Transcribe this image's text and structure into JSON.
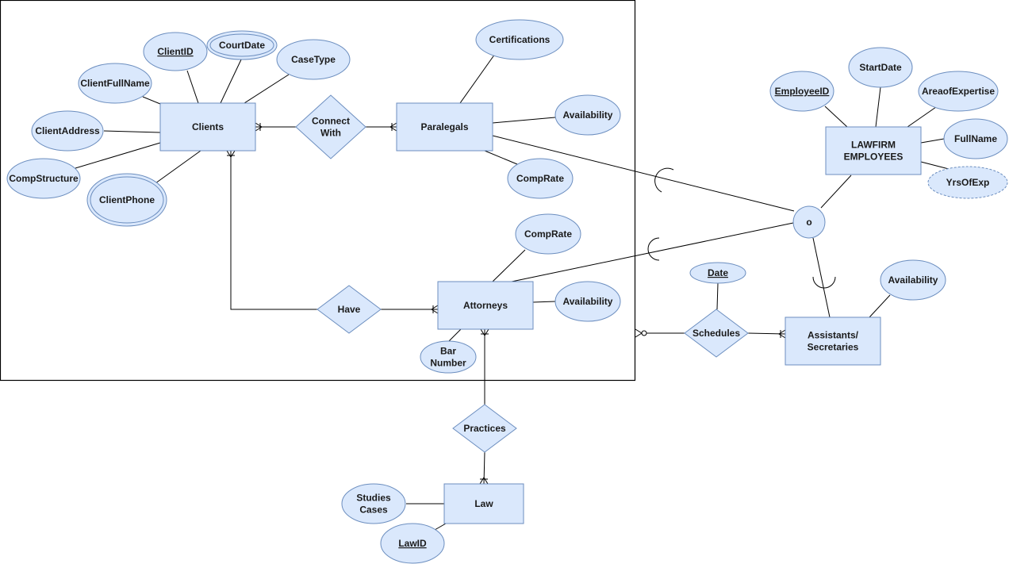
{
  "diagram": {
    "type": "ER diagram",
    "colors": {
      "fill": "#dae8fc",
      "stroke": "#6c8ebf",
      "line": "#000000",
      "background": "#ffffff"
    },
    "entities": [
      {
        "id": "clients",
        "label": "Clients"
      },
      {
        "id": "paralegals",
        "label": "Paralegals"
      },
      {
        "id": "attorneys",
        "label": "Attorneys"
      },
      {
        "id": "law",
        "label": "Law"
      },
      {
        "id": "lawfirm",
        "label": "LAWFIRM EMPLOYEES",
        "lines": [
          "LAWFIRM",
          "EMPLOYEES"
        ]
      },
      {
        "id": "assistants",
        "label": "Assistants/ Secretaries",
        "lines": [
          "Assistants/",
          "Secretaries"
        ]
      }
    ],
    "relationships": [
      {
        "id": "connect",
        "label": "Connect With",
        "lines": [
          "Connect",
          "With"
        ]
      },
      {
        "id": "have",
        "label": "Have"
      },
      {
        "id": "practices",
        "label": "Practices"
      },
      {
        "id": "schedules",
        "label": "Schedules"
      }
    ],
    "specialization": {
      "id": "overlap",
      "label": "o"
    },
    "attributes": [
      {
        "id": "clientid",
        "label": "ClientID",
        "key": true,
        "of": "Clients"
      },
      {
        "id": "courtdate",
        "label": "CourtDate",
        "multivalued": true,
        "of": "Clients"
      },
      {
        "id": "casetype",
        "label": "CaseType",
        "of": "Clients"
      },
      {
        "id": "clientfullname",
        "label": "ClientFullName",
        "of": "Clients"
      },
      {
        "id": "clientaddress",
        "label": "ClientAddress",
        "of": "Clients"
      },
      {
        "id": "compstructure",
        "label": "CompStructure",
        "of": "Clients"
      },
      {
        "id": "clientphone",
        "label": "ClientPhone",
        "multivalued": true,
        "of": "Clients"
      },
      {
        "id": "certifications",
        "label": "Certifications",
        "of": "Paralegals"
      },
      {
        "id": "para_availability",
        "label": "Availability",
        "of": "Paralegals"
      },
      {
        "id": "para_comprate",
        "label": "CompRate",
        "of": "Paralegals"
      },
      {
        "id": "att_comprate",
        "label": "CompRate",
        "of": "Attorneys"
      },
      {
        "id": "att_availability",
        "label": "Availability",
        "of": "Attorneys"
      },
      {
        "id": "barnumber",
        "label": "Bar Number",
        "lines": [
          "Bar",
          "Number"
        ],
        "of": "Attorneys"
      },
      {
        "id": "studiescases",
        "label": "Studies Cases",
        "lines": [
          "Studies",
          "Cases"
        ],
        "of": "Law"
      },
      {
        "id": "lawid",
        "label": "LawID",
        "key": true,
        "of": "Law"
      },
      {
        "id": "employeeid",
        "label": "EmployeeID",
        "key": true,
        "of": "LAWFIRM EMPLOYEES"
      },
      {
        "id": "startdate",
        "label": "StartDate",
        "of": "LAWFIRM EMPLOYEES"
      },
      {
        "id": "areaofexpertise",
        "label": "AreaofExpertise",
        "of": "LAWFIRM EMPLOYEES"
      },
      {
        "id": "fullname",
        "label": "FullName",
        "of": "LAWFIRM EMPLOYEES"
      },
      {
        "id": "yrsofexp",
        "label": "YrsOfExp",
        "derived": true,
        "of": "LAWFIRM EMPLOYEES"
      },
      {
        "id": "date",
        "label": "Date",
        "key": true,
        "of": "Schedules"
      },
      {
        "id": "asst_availability",
        "label": "Availability",
        "of": "Assistants/ Secretaries"
      }
    ],
    "connections": [
      {
        "from": "Clients",
        "to": "Connect With",
        "cardinality": "one-or-many"
      },
      {
        "from": "Connect With",
        "to": "Paralegals",
        "cardinality": "one-or-many"
      },
      {
        "from": "Clients",
        "to": "Have",
        "cardinality": "one-or-many"
      },
      {
        "from": "Have",
        "to": "Attorneys",
        "cardinality": "one-or-many"
      },
      {
        "from": "Attorneys",
        "to": "Practices",
        "cardinality": "one-or-many"
      },
      {
        "from": "Practices",
        "to": "Law",
        "cardinality": "one-or-many"
      },
      {
        "from": "Schedules",
        "to": "Attorneys group",
        "cardinality": "zero-or-many"
      },
      {
        "from": "Schedules",
        "to": "Assistants/ Secretaries",
        "cardinality": "one-or-many"
      },
      {
        "from": "o",
        "to": "LAWFIRM EMPLOYEES",
        "cardinality": "superclass"
      },
      {
        "from": "o",
        "to": "Paralegals",
        "cardinality": "subset"
      },
      {
        "from": "o",
        "to": "Attorneys",
        "cardinality": "subset"
      },
      {
        "from": "o",
        "to": "Assistants/ Secretaries",
        "cardinality": "subset"
      }
    ]
  }
}
